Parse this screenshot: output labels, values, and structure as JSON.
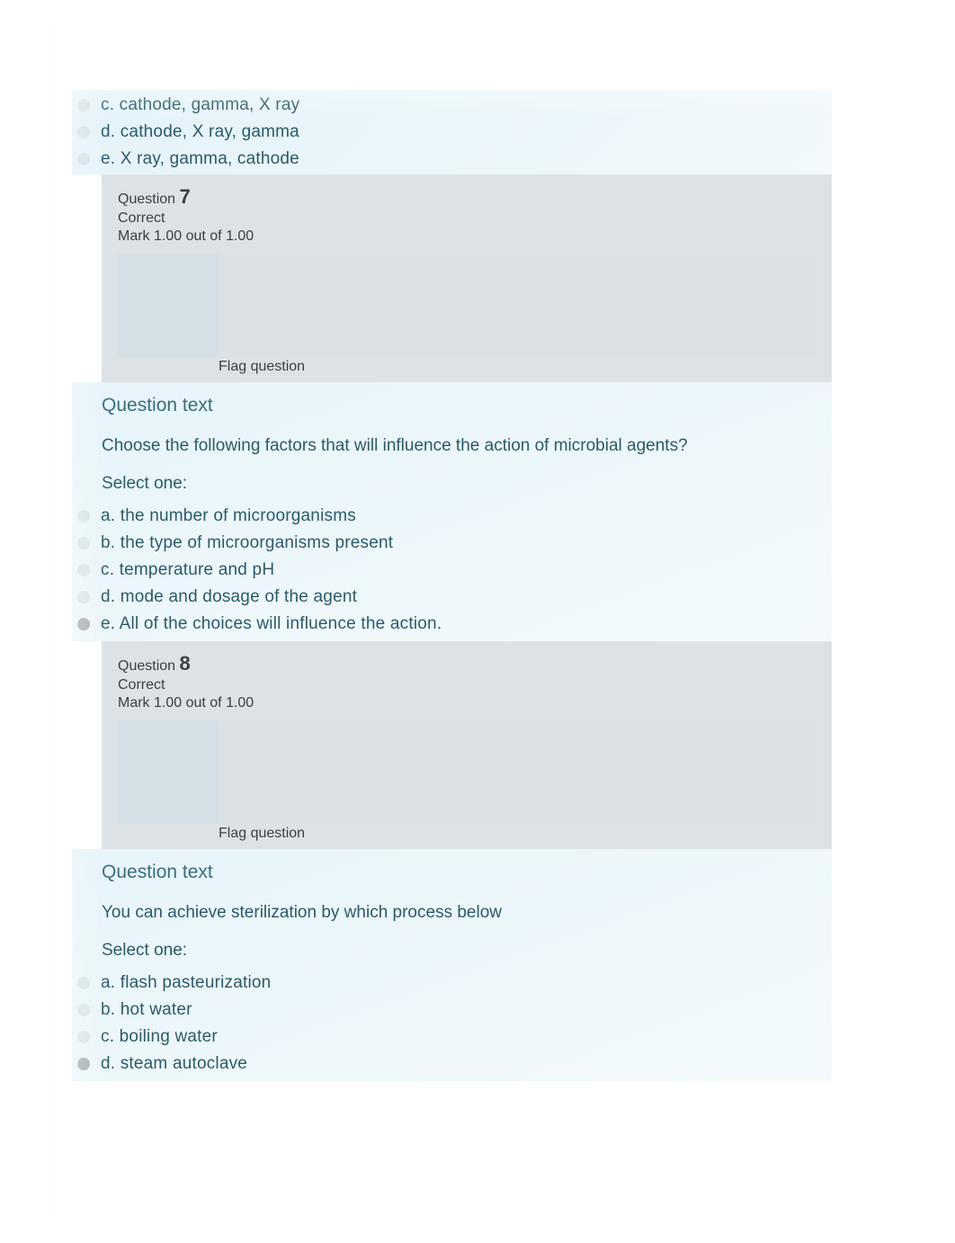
{
  "partial_options": {
    "c": "c. cathode, gamma, X ray",
    "d": "d. cathode, X ray, gamma",
    "e": "e. X ray, gamma, cathode"
  },
  "q7": {
    "label": "Question ",
    "number": "7",
    "status": "Correct",
    "mark": "Mark 1.00 out of 1.00",
    "flag": "Flag question",
    "heading": "Question text",
    "prompt": "Choose the following factors that will influence the action of microbial agents?",
    "select": "Select one:",
    "options": {
      "a": "a. the number of microorganisms",
      "b": "b. the type of microorganisms present",
      "c": "c. temperature and pH",
      "d": "d. mode and dosage of the agent",
      "e": "e. All of the choices will influence the action."
    }
  },
  "q8": {
    "label": "Question ",
    "number": "8",
    "status": "Correct",
    "mark": "Mark 1.00 out of 1.00",
    "flag": "Flag question",
    "heading": "Question text",
    "prompt": "You can achieve sterilization by which process below",
    "select": "Select one:",
    "options": {
      "a": "a. flash pasteurization",
      "b": "b. hot water",
      "c": "c. boiling water",
      "d": "d. steam autoclave"
    }
  }
}
